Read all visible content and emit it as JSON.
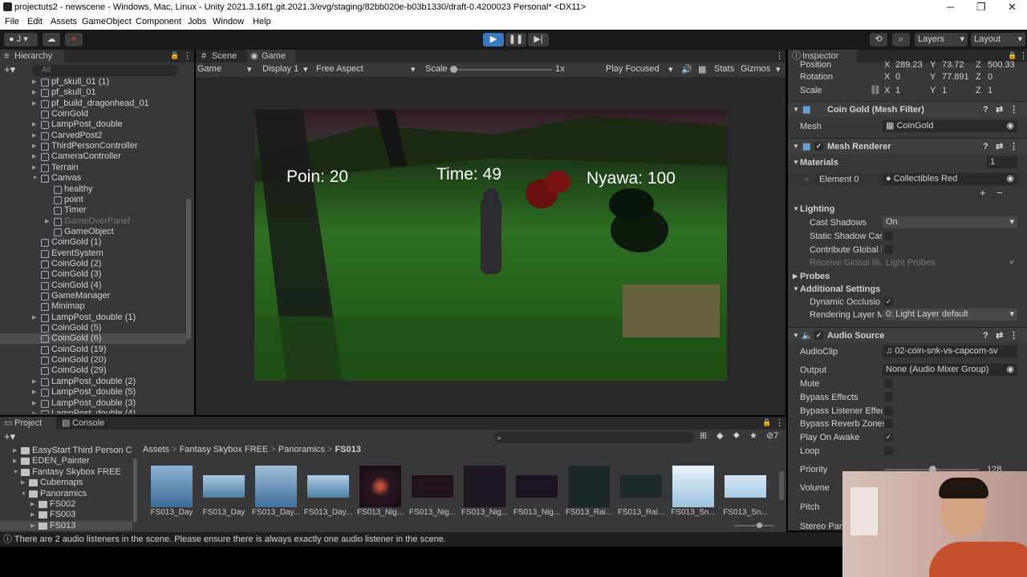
{
  "window": {
    "title": "projectuts2 - newscene - Windows, Mac, Linux - Unity 2021.3.16f1.git.2021.3/evg/staging/82bb020e-b03b1330/draft-0.4200023 Personal* <DX11>"
  },
  "menu": [
    "File",
    "Edit",
    "Assets",
    "GameObject",
    "Component",
    "Jobs",
    "Window",
    "Help"
  ],
  "toolbar": {
    "account": "J",
    "layers": "Layers",
    "layout": "Layout"
  },
  "hierarchy": {
    "tab": "Hierarchy",
    "search_placeholder": "All",
    "items": [
      {
        "label": "pf_skull_01 (1)",
        "depth": 1,
        "exp": true,
        "dim": false
      },
      {
        "label": "pf_skull_01",
        "depth": 1,
        "exp": true,
        "dim": false
      },
      {
        "label": "pf_build_dragonhead_01",
        "depth": 1,
        "exp": true,
        "dim": false
      },
      {
        "label": "CoinGold",
        "depth": 1,
        "exp": false,
        "dim": false
      },
      {
        "label": "LampPost_double",
        "depth": 1,
        "exp": true,
        "dim": false
      },
      {
        "label": "CarvedPost2",
        "depth": 1,
        "exp": true,
        "dim": false
      },
      {
        "label": "ThirdPersonController",
        "depth": 1,
        "exp": true,
        "dim": false
      },
      {
        "label": "CameraController",
        "depth": 1,
        "exp": true,
        "dim": false
      },
      {
        "label": "Terrain",
        "depth": 1,
        "exp": true,
        "dim": false
      },
      {
        "label": "Canvas",
        "depth": 1,
        "exp": true,
        "open": true,
        "dim": false
      },
      {
        "label": "healthy",
        "depth": 2,
        "exp": false,
        "dim": false
      },
      {
        "label": "point",
        "depth": 2,
        "exp": false,
        "dim": false
      },
      {
        "label": "Timer",
        "depth": 2,
        "exp": false,
        "dim": false
      },
      {
        "label": "GameOverPanel",
        "depth": 2,
        "exp": true,
        "dim": true
      },
      {
        "label": "GameObject",
        "depth": 2,
        "exp": false,
        "dim": false
      },
      {
        "label": "CoinGold (1)",
        "depth": 1,
        "exp": false,
        "dim": false
      },
      {
        "label": "EventSystem",
        "depth": 1,
        "exp": false,
        "dim": false
      },
      {
        "label": "CoinGold (2)",
        "depth": 1,
        "exp": false,
        "dim": false
      },
      {
        "label": "CoinGold (3)",
        "depth": 1,
        "exp": false,
        "dim": false
      },
      {
        "label": "CoinGold (4)",
        "depth": 1,
        "exp": false,
        "dim": false
      },
      {
        "label": "GameManager",
        "depth": 1,
        "exp": false,
        "dim": false
      },
      {
        "label": "Minimap",
        "depth": 1,
        "exp": false,
        "dim": false
      },
      {
        "label": "LampPost_double (1)",
        "depth": 1,
        "exp": true,
        "dim": false
      },
      {
        "label": "CoinGold (5)",
        "depth": 1,
        "exp": false,
        "dim": false
      },
      {
        "label": "CoinGold (6)",
        "depth": 1,
        "exp": false,
        "dim": false,
        "sel": true
      },
      {
        "label": "CoinGold (19)",
        "depth": 1,
        "exp": false,
        "dim": false
      },
      {
        "label": "CoinGold (20)",
        "depth": 1,
        "exp": false,
        "dim": false
      },
      {
        "label": "CoinGold (29)",
        "depth": 1,
        "exp": false,
        "dim": false
      },
      {
        "label": "LampPost_double (2)",
        "depth": 1,
        "exp": true,
        "dim": false
      },
      {
        "label": "LampPost_double (5)",
        "depth": 1,
        "exp": true,
        "dim": false
      },
      {
        "label": "LampPost_double (3)",
        "depth": 1,
        "exp": true,
        "dim": false
      },
      {
        "label": "LampPost_double (4)",
        "depth": 1,
        "exp": true,
        "dim": false
      }
    ]
  },
  "scene": {
    "tab_scene": "Scene",
    "tab_game": "Game",
    "display_mode": "Game",
    "display": "Display 1",
    "aspect": "Free Aspect",
    "scale_label": "Scale",
    "scale_value": "1x",
    "play_mode": "Play Focused",
    "stats": "Stats",
    "gizmos": "Gizmos"
  },
  "game_hud": {
    "points": "Poin: 20",
    "time": "Time: 49",
    "lives": "Nyawa: 100"
  },
  "inspector": {
    "tab": "Inspector",
    "position": {
      "label": "Position",
      "x": "289.23",
      "y": "73.72",
      "z": "500.33"
    },
    "rotation": {
      "label": "Rotation",
      "x": "0",
      "y": "77.891",
      "z": "0"
    },
    "scale": {
      "label": "Scale",
      "x": "1",
      "y": "1",
      "z": "1"
    },
    "mesh_filter": {
      "title": "Coin Gold (Mesh Filter)",
      "mesh_label": "Mesh",
      "mesh_value": "CoinGold"
    },
    "mesh_renderer": {
      "title": "Mesh Renderer",
      "materials": "Materials",
      "materials_count": "1",
      "element0_label": "Element 0",
      "element0_value": "Collectibles Red",
      "lighting": "Lighting",
      "cast_shadows_label": "Cast Shadows",
      "cast_shadows_value": "On",
      "static_shadow": "Static Shadow Cas",
      "contribute_gi": "Contribute Global I",
      "receive_gi": "Receive Global Illu",
      "receive_gi_value": "Light Probes",
      "probes": "Probes",
      "additional": "Additional Settings",
      "dynamic_occ": "Dynamic Occlusio",
      "rendering_layer": "Rendering Layer M",
      "rendering_layer_value": "0: Light Layer default"
    },
    "audio_source": {
      "title": "Audio Source",
      "clip_label": "AudioClip",
      "clip_value": "02-coin-snk-vs-capcom-sv",
      "output_label": "Output",
      "output_value": "None (Audio Mixer Group)",
      "mute": "Mute",
      "bypass_effects": "Bypass Effects",
      "bypass_listener": "Bypass Listener Effec",
      "bypass_reverb": "Bypass Reverb Zones",
      "play_on_awake": "Play On Awake",
      "loop": "Loop",
      "priority_label": "Priority",
      "priority_value": "128",
      "volume": "Volume",
      "pitch": "Pitch",
      "stereo_pan": "Stereo Pan"
    }
  },
  "project": {
    "tab_project": "Project",
    "tab_console": "Console",
    "badge": "7",
    "tree": [
      {
        "label": "EasyStart Third Person Co",
        "depth": 1
      },
      {
        "label": "EDEN_Painter",
        "depth": 1
      },
      {
        "label": "Fantasy Skybox FREE",
        "depth": 1
      },
      {
        "label": "Cubemaps",
        "depth": 2
      },
      {
        "label": "Panoramics",
        "depth": 2
      },
      {
        "label": "FS002",
        "depth": 3
      },
      {
        "label": "FS003",
        "depth": 3
      },
      {
        "label": "FS013",
        "depth": 3
      }
    ],
    "breadcrumb": [
      "Assets",
      "Fantasy Skybox FREE",
      "Panoramics",
      "FS013"
    ],
    "assets": [
      "FS013_Day",
      "FS013_Day",
      "FS013_Day...",
      "FS013_Day...",
      "FS013_Nig...",
      "FS013_Nig...",
      "FS013_Nig...",
      "FS013_Nig...",
      "FS013_Rai...",
      "FS013_Rai...",
      "FS013_Sn...",
      "FS013_Sn..."
    ]
  },
  "status": {
    "message": "There are 2 audio listeners in the scene. Please ensure there is always exactly one audio listener in the scene."
  },
  "colors": {
    "accent": "#3a79bb",
    "panel": "#383838",
    "grass": "#2a6e1f",
    "hud_text": "#ffffff"
  }
}
